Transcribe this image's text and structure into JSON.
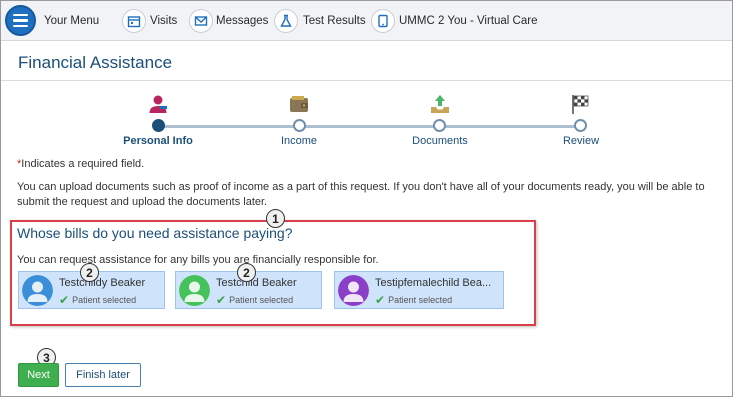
{
  "nav": {
    "menu_label": "Your Menu",
    "items": [
      {
        "label": "Visits",
        "icon": "calendar-icon"
      },
      {
        "label": "Messages",
        "icon": "envelope-icon"
      },
      {
        "label": "Test Results",
        "icon": "flask-icon"
      },
      {
        "label": "UMMC 2 You - Virtual Care",
        "icon": "tablet-icon"
      }
    ]
  },
  "page": {
    "title": "Financial Assistance"
  },
  "stepper": {
    "steps": [
      {
        "label": "Personal Info",
        "icon": "person-icon",
        "active": true
      },
      {
        "label": "Income",
        "icon": "wallet-icon",
        "active": false
      },
      {
        "label": "Documents",
        "icon": "upload-tray-icon",
        "active": false
      },
      {
        "label": "Review",
        "icon": "checkered-flag-icon",
        "active": false
      }
    ]
  },
  "required_note": "Indicates a required field.",
  "intro": "You can upload documents such as proof of income as a part of this request. If you don't have all of your documents ready, you will be able to submit the request and upload the documents later.",
  "section": {
    "title": "Whose bills do you need assistance paying?",
    "subtitle": "You can request assistance for any bills you are financially responsible for."
  },
  "patients": [
    {
      "name": "Testchildy Beaker",
      "status": "Patient selected",
      "color": "#3b8fd9"
    },
    {
      "name": "Testchild Beaker",
      "status": "Patient selected",
      "color": "#46c25a"
    },
    {
      "name": "Testipfemalechild Bea...",
      "status": "Patient selected",
      "color": "#8b3fc9"
    }
  ],
  "callouts": [
    "1",
    "2",
    "2",
    "3"
  ],
  "buttons": {
    "next": "Next",
    "finish_later": "Finish later"
  },
  "colors": {
    "brand": "#1b4f7a",
    "accent_blue": "#1f6fc0",
    "next_green": "#3fae4f",
    "highlight_red": "#d9404a"
  }
}
